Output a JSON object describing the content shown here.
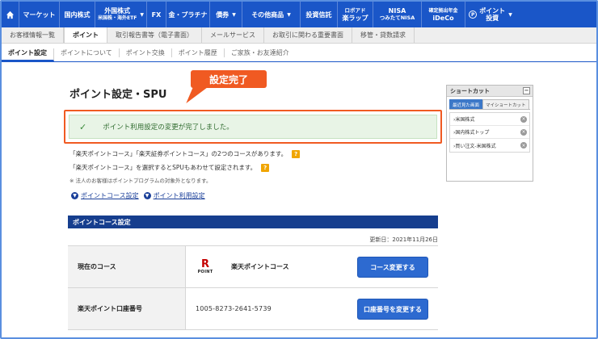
{
  "topnav": {
    "items": [
      {
        "label": "マーケット"
      },
      {
        "label": "国内株式"
      },
      {
        "label": "外国株式",
        "sub": "米国株・海外ETF"
      },
      {
        "label": "FX"
      },
      {
        "label": "金・プラチナ"
      },
      {
        "label": "債券"
      },
      {
        "label": "その他商品"
      },
      {
        "label": "投資信託"
      },
      {
        "label": "ロボアド",
        "sub": "楽ラップ"
      },
      {
        "label": "NISA",
        "sub": "つみたてNISA"
      },
      {
        "label": "確定拠出年金",
        "sub": "iDeCo"
      },
      {
        "label": "ポイント",
        "sub": "投資"
      }
    ]
  },
  "subnav": {
    "items": [
      "お客様情報一覧",
      "ポイント",
      "取引報告書等（電子書面）",
      "メールサービス",
      "お取引に関わる重要書面",
      "移管・貸数請求"
    ]
  },
  "subnav2": {
    "items": [
      "ポイント設定",
      "ポイントについて",
      "ポイント交換",
      "ポイント履歴",
      "ご家族・お友達紹介"
    ]
  },
  "page": {
    "title": "ポイント設定・SPU",
    "callout": "設定完了",
    "success_message": "ポイント利用設定の変更が完了しました。",
    "info1": "「楽天ポイントコース」「楽天証券ポイントコース」の2つのコースがあります。",
    "info2": "「楽天ポイントコース」を選択するとSPUもあわせて設定されます。",
    "note": "※ 法人のお客様はポイントプログラムの対象外となります。",
    "link1": "ポイントコース設定",
    "link2": "ポイント利用設定"
  },
  "course_section": {
    "header": "ポイントコース設定",
    "updated": "更新日：2021年11月26日",
    "row1_label": "現在のコース",
    "row1_logo_r": "R",
    "row1_logo_text": "POINT",
    "row1_value": "楽天ポイントコース",
    "row1_button": "コース変更する",
    "row2_label": "楽天ポイント口座番号",
    "row2_value": "1005-8273-2641-5739",
    "row2_button": "口座番号を変更する"
  },
  "shortcut": {
    "title": "ショートカット",
    "tab_active": "最近見た画面",
    "tab_other": "マイショートカット",
    "items": [
      "米国株式",
      "国内株式トップ",
      "買い注文-米国株式"
    ]
  },
  "colors": {
    "nav_blue": "#1a56c8",
    "accent_orange": "#f05a22",
    "success_bg": "#e8f4e6",
    "section_navy": "#163e8e",
    "button_blue": "#2d6ad0"
  }
}
